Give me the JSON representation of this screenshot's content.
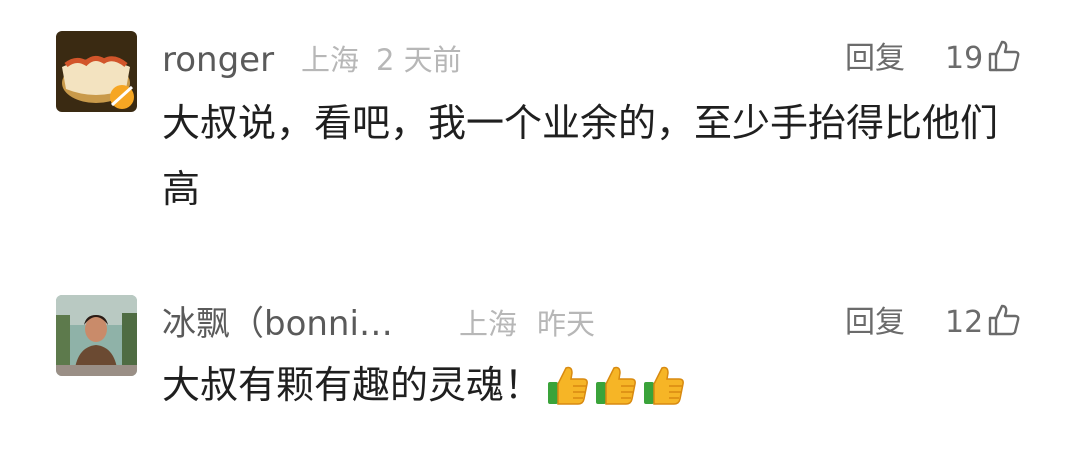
{
  "comments": [
    {
      "username": "ronger",
      "location": "上海",
      "time": "2 天前",
      "reply_label": "回复",
      "likes": "19",
      "text": "大叔说，看吧，我一个业余的，至少手抬得比他们高",
      "avatar_icon": "avatar-image",
      "like_icon": "thumbs-up-outline-icon"
    },
    {
      "username": "冰飘（bonni…",
      "location": "上海",
      "time": "昨天",
      "reply_label": "回复",
      "likes": "12",
      "text": "大叔有颗有趣的灵魂！",
      "emoji_icons": [
        "thumbs-up-emoji-icon",
        "thumbs-up-emoji-icon",
        "thumbs-up-emoji-icon"
      ],
      "avatar_icon": "avatar-image",
      "like_icon": "thumbs-up-outline-icon"
    }
  ],
  "colors": {
    "username": "#5a5a5a",
    "meta": "#b7b7b7",
    "text": "#1f1f1f",
    "action": "#6b6b6b",
    "thumb_emoji": "#f3a51c"
  }
}
